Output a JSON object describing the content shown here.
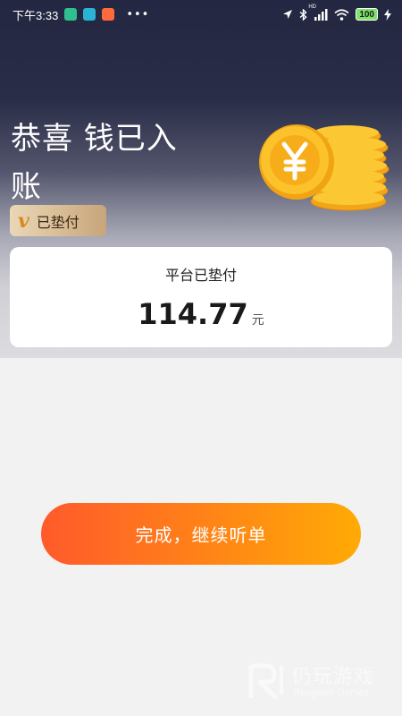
{
  "status_bar": {
    "time": "下午3:33",
    "dots": "•••",
    "network_label": "HD",
    "battery": "100"
  },
  "hero": {
    "title_line1": "恭喜 钱已入",
    "title_line2": "账",
    "paid_badge": {
      "mark": "v",
      "label": "已垫付"
    }
  },
  "card": {
    "label": "平台已垫付",
    "amount": "114.77",
    "unit": "元"
  },
  "finish_button": {
    "label": "完成，继续听单"
  },
  "watermark": {
    "cn": "仍玩游戏",
    "en": "Rengwan Games"
  },
  "colors": {
    "hero_top": "#242741",
    "button_start": "#ff5a2b",
    "button_end": "#ffab05",
    "coin": "#f7b51e"
  }
}
